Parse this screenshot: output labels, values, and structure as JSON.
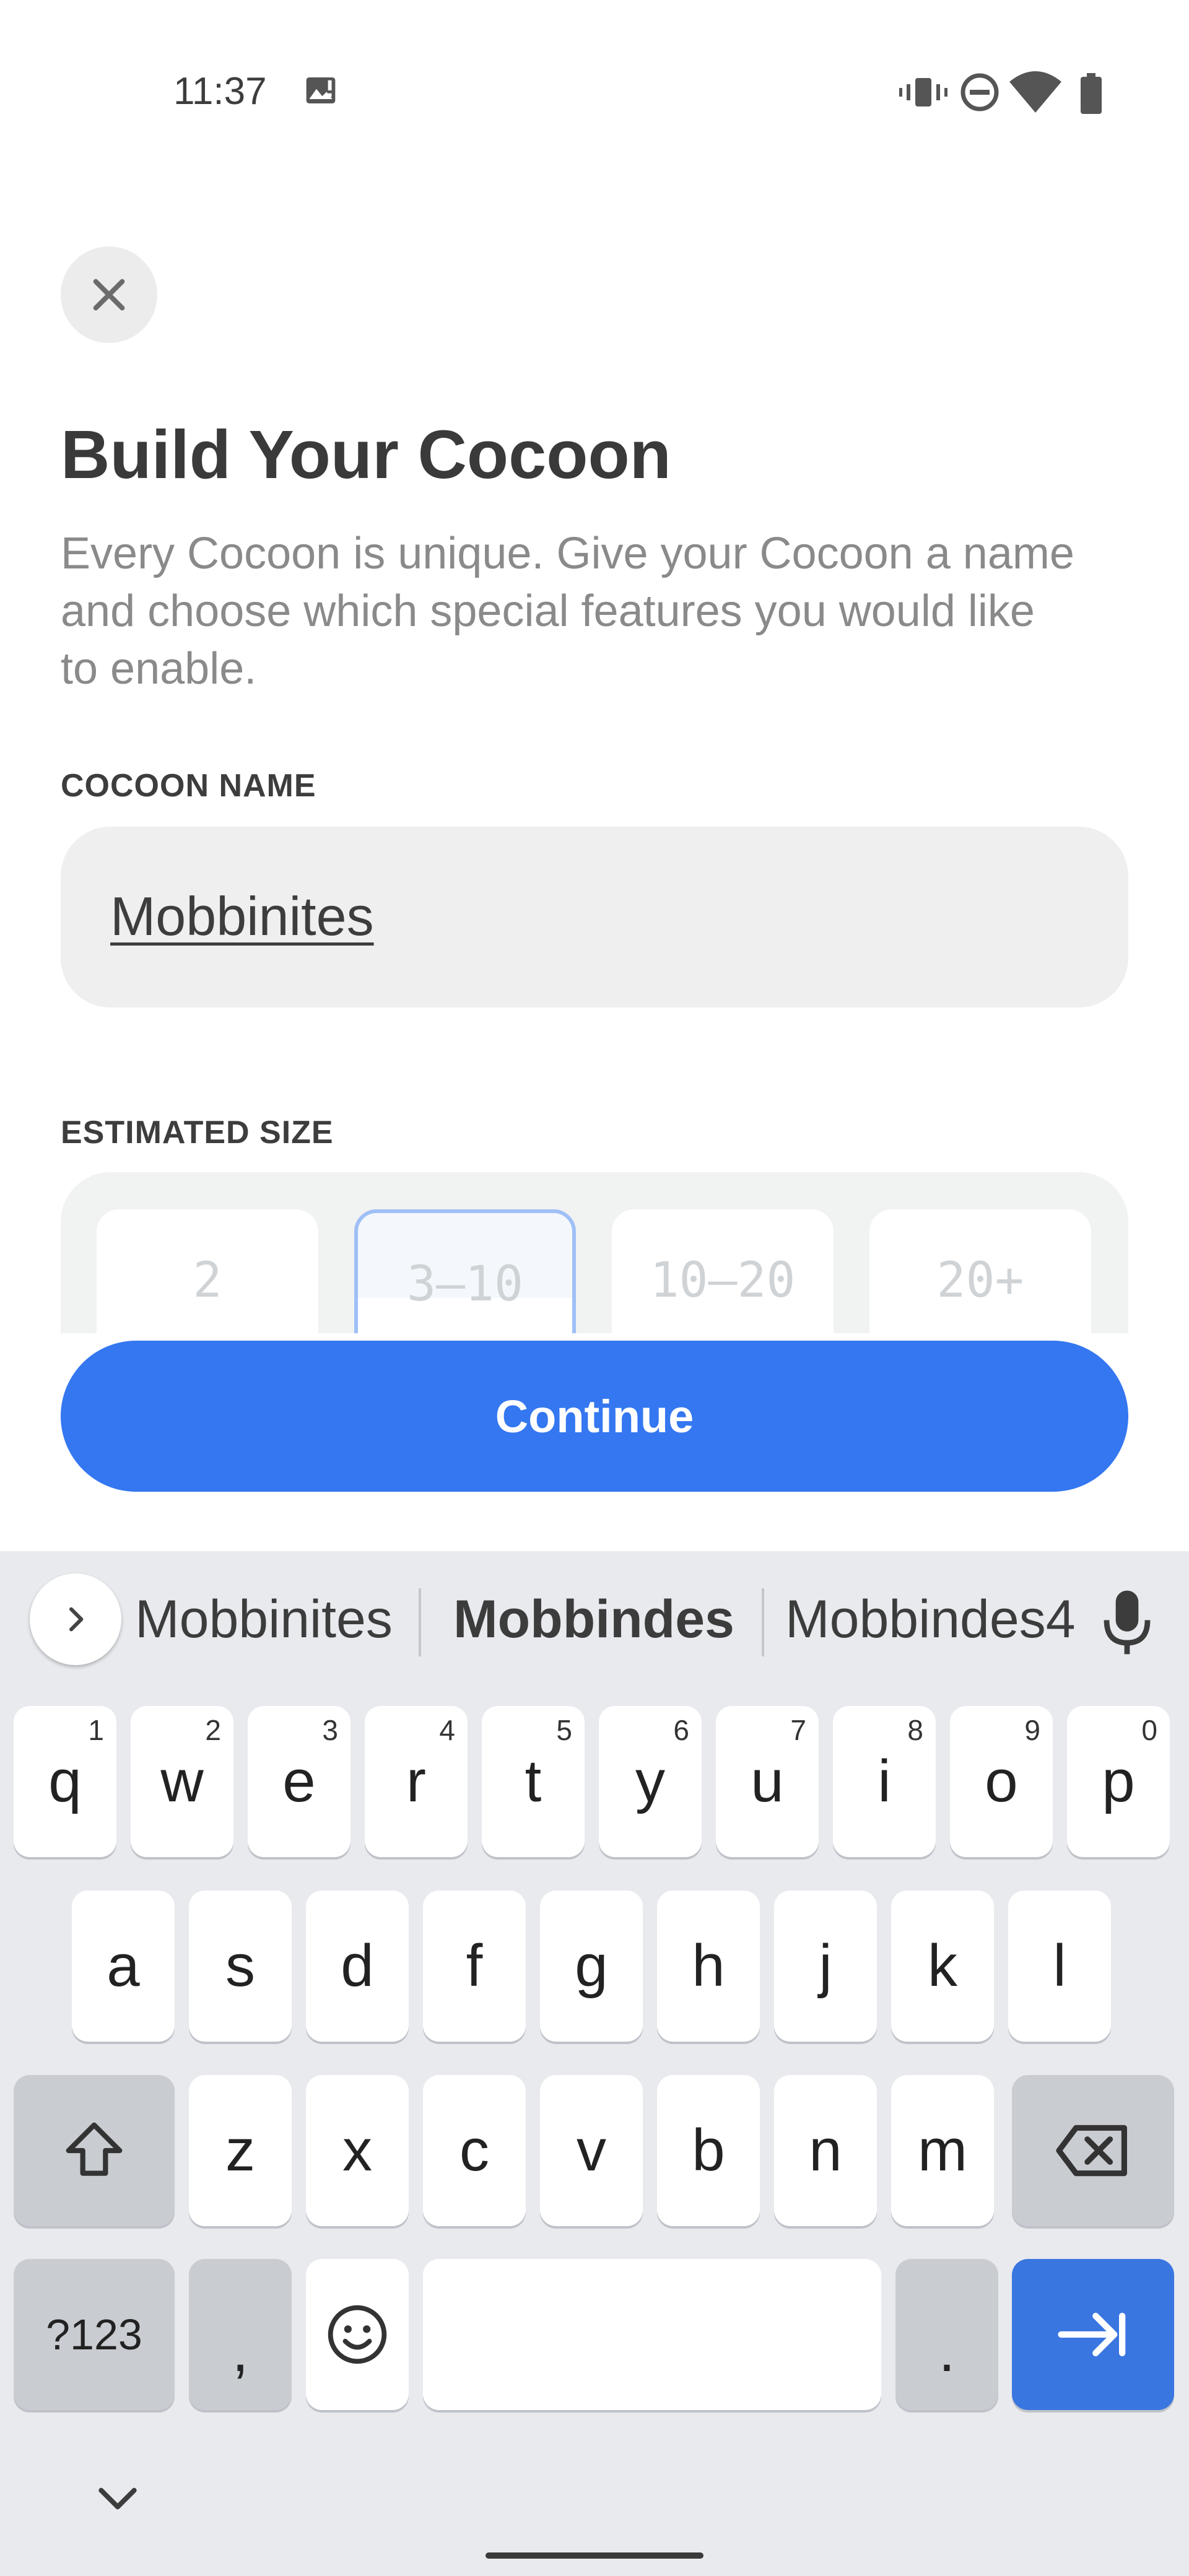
{
  "status_bar": {
    "time": "11:37"
  },
  "header": {
    "close_icon": "close-icon"
  },
  "title": "Build Your Cocoon",
  "subtitle": "Every Cocoon is unique. Give your Cocoon a name and choose which special features you would like to enable.",
  "name_section": {
    "label": "COCOON NAME",
    "value": "Mobbinites"
  },
  "size_section": {
    "label": "ESTIMATED SIZE",
    "options": [
      "2",
      "3–10",
      "10–20",
      "20+"
    ],
    "selected": "3–10"
  },
  "continue_label": "Continue",
  "keyboard": {
    "suggestions": [
      "Mobbinites",
      "Mobbindes",
      "Mobbindes4"
    ],
    "row1": [
      "q",
      "w",
      "e",
      "r",
      "t",
      "y",
      "u",
      "i",
      "o",
      "p"
    ],
    "row1_hints": [
      "1",
      "2",
      "3",
      "4",
      "5",
      "6",
      "7",
      "8",
      "9",
      "0"
    ],
    "row2": [
      "a",
      "s",
      "d",
      "f",
      "g",
      "h",
      "j",
      "k",
      "l"
    ],
    "row3": [
      "z",
      "x",
      "c",
      "v",
      "b",
      "n",
      "m"
    ],
    "symbols_label": "?123",
    "comma": ",",
    "period": ".",
    "accent_color": "#3a76e0"
  },
  "colors": {
    "primary": "#3477f0",
    "field_bg": "#efefef"
  }
}
